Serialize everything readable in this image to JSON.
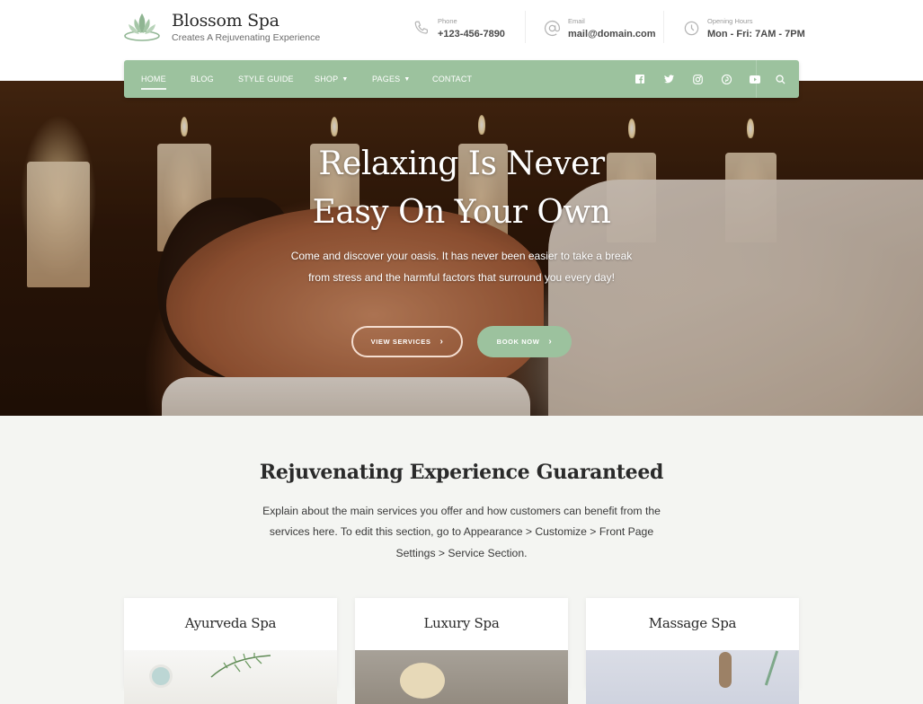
{
  "brand": {
    "name": "Blossom Spa",
    "tagline": "Creates A Rejuvenating Experience",
    "logo_icon": "lotus-icon",
    "accent_color": "#9cc29e"
  },
  "contacts": [
    {
      "icon": "phone-icon",
      "label": "Phone",
      "value": "+123-456-7890"
    },
    {
      "icon": "at-sign-icon",
      "label": "Email",
      "value": "mail@domain.com"
    },
    {
      "icon": "clock-icon",
      "label": "Opening Hours",
      "value": "Mon - Fri: 7AM - 7PM"
    }
  ],
  "nav": {
    "items": [
      {
        "label": "HOME",
        "active": true,
        "dropdown": false
      },
      {
        "label": "BLOG",
        "active": false,
        "dropdown": false
      },
      {
        "label": "STYLE GUIDE",
        "active": false,
        "dropdown": false
      },
      {
        "label": "SHOP",
        "active": false,
        "dropdown": true
      },
      {
        "label": "PAGES",
        "active": false,
        "dropdown": true
      },
      {
        "label": "CONTACT",
        "active": false,
        "dropdown": false
      }
    ],
    "chevron": "⌄",
    "social": [
      "facebook-icon",
      "twitter-icon",
      "instagram-icon",
      "pinterest-icon",
      "youtube-icon"
    ],
    "search_icon": "search-icon"
  },
  "hero": {
    "title_line1": "Relaxing Is Never",
    "title_line2": "Easy On Your Own",
    "description": "Come and discover your oasis. It has never been easier to take a break from stress and the harmful factors that surround you every day!",
    "button_primary": "VIEW SERVICES",
    "button_secondary": "BOOK NOW",
    "arrow": "›"
  },
  "services": {
    "title": "Rejuvenating Experience Guaranteed",
    "description": "Explain about the main services you offer and how customers can benefit from the services here. To edit this section, go to Appearance > Customize > Front Page Settings > Service Section.",
    "cards": [
      {
        "title": "Ayurveda Spa"
      },
      {
        "title": "Luxury Spa"
      },
      {
        "title": "Massage Spa"
      }
    ]
  }
}
